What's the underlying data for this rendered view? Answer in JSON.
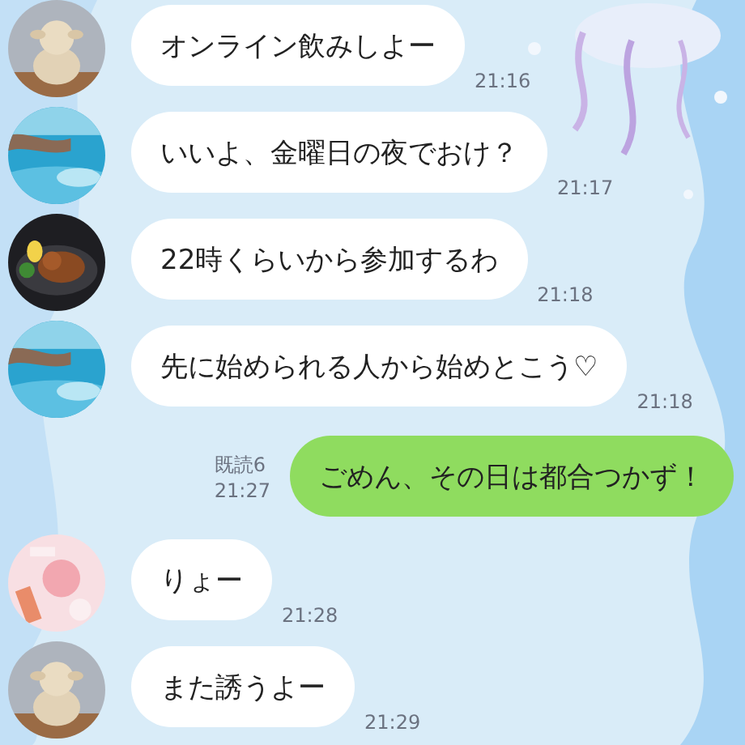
{
  "messages": [
    {
      "kind": "incoming",
      "text": "オンライン飲みしよー",
      "time": "21:16"
    },
    {
      "kind": "incoming",
      "text": "いいよ、金曜日の夜でおけ？",
      "time": "21:17"
    },
    {
      "kind": "incoming",
      "text": "22時くらいから参加するわ",
      "time": "21:18"
    },
    {
      "kind": "incoming",
      "text": "先に始められる人から始めとこう♡",
      "time": "21:18"
    },
    {
      "kind": "outgoing",
      "text": "ごめん、その日は都合つかず！",
      "read": "既読6",
      "time": "21:27"
    },
    {
      "kind": "incoming",
      "text": "りょー",
      "time": "21:28"
    },
    {
      "kind": "incoming",
      "text": "また誘うよー",
      "time": "21:29"
    }
  ]
}
